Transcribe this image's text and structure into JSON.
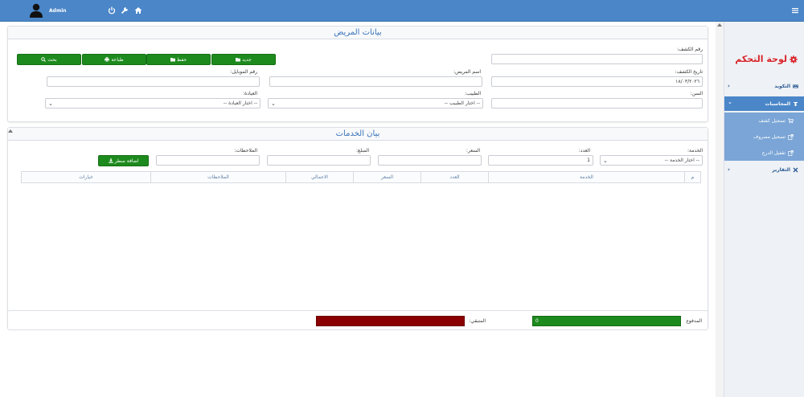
{
  "topbar": {
    "user_name": "Admin"
  },
  "sidebar": {
    "title": "لوحة التحكم",
    "items": [
      {
        "label": "التكويد"
      },
      {
        "label": "المحاسبات"
      },
      {
        "label": "التقارير"
      }
    ],
    "subitems": [
      {
        "label": "تسجيل كشف"
      },
      {
        "label": "تسجيل مصروف"
      },
      {
        "label": "تقفيل الدرج"
      }
    ]
  },
  "patient": {
    "title": "بيانات المريض",
    "exam_no_label": "رقم الكشف:",
    "exam_date_label": "تاريخ الكشف:",
    "exam_date_value": "١٨/٠٣/٢٠٢٦",
    "patient_name_label": "اسم المريض:",
    "mobile_label": "رقم الموبايل:",
    "age_label": "السن:",
    "doctor_label": "الطبيب:",
    "doctor_placeholder": "-- اختار الطبيب --",
    "clinic_label": "العيادة:",
    "clinic_placeholder": "-- اختار العيادة --",
    "buttons": {
      "new": "جديد",
      "save": "حفظ",
      "print": "طباعة",
      "search": "بحث"
    }
  },
  "services": {
    "title": "بيان الخدمات",
    "service_label": "الخدمة:",
    "service_placeholder": "-- اختار الخدمة --",
    "count_label": "العدد:",
    "count_value": "1",
    "price_label": "السعر:",
    "amount_label": "المبلغ:",
    "notes_label": "الملاحظات:",
    "add_row_button": "اضافة سطر",
    "columns": [
      "م",
      "الخدمة",
      "العدد",
      "السعر",
      "الاجمالي",
      "الملاحظات",
      "خيارات"
    ]
  },
  "totals": {
    "paid_label": "المدفوع",
    "paid_value": "0",
    "remaining_label": "المتبقي:"
  },
  "colors": {
    "header": "#4a86c8",
    "green": "#1d8a1d",
    "red": "#8b0000",
    "brand_red": "#d9242a"
  }
}
